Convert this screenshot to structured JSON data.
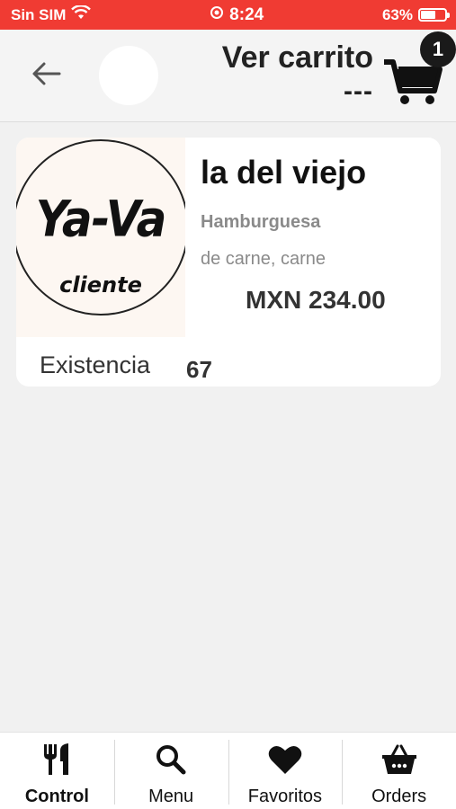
{
  "status_bar": {
    "carrier": "Sin SIM",
    "time": "8:24",
    "battery": "63%",
    "battery_level": 0.63
  },
  "header": {
    "title": "Ver carrito",
    "total": "---",
    "cart_count": "1"
  },
  "product": {
    "logo_text": "Ya-Va",
    "logo_subtext": "cliente",
    "name": "la del viejo",
    "category": "Hamburguesa",
    "description": "de carne, carne",
    "price": "MXN 234.00",
    "stock_label": "Existencia",
    "stock_value": "67"
  },
  "nav": {
    "items": [
      {
        "label": "Control",
        "icon": "utensils-icon",
        "active": true
      },
      {
        "label": "Menu",
        "icon": "search-icon",
        "active": false
      },
      {
        "label": "Favoritos",
        "icon": "heart-icon",
        "active": false
      },
      {
        "label": "Orders",
        "icon": "basket-icon",
        "active": false
      }
    ]
  },
  "colors": {
    "accent": "#f03b33",
    "background": "#f1f1f1",
    "card": "#ffffff"
  }
}
